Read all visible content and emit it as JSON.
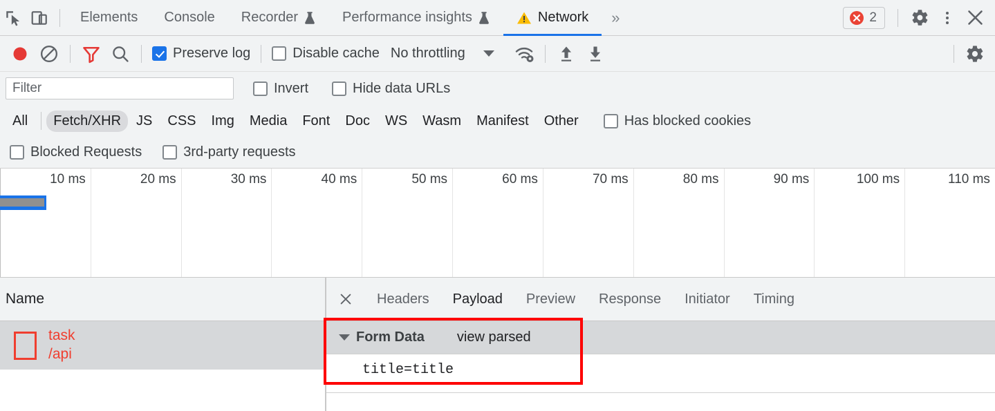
{
  "tabbar": {
    "inspect_icon": "inspect-cursor-icon",
    "device_icon": "device-toolbar-icon",
    "tabs": [
      {
        "label": "Elements",
        "selected": false,
        "flask": false,
        "warning": false
      },
      {
        "label": "Console",
        "selected": false,
        "flask": false,
        "warning": false
      },
      {
        "label": "Recorder",
        "selected": false,
        "flask": true,
        "warning": false
      },
      {
        "label": "Performance insights",
        "selected": false,
        "flask": true,
        "warning": false
      },
      {
        "label": "Network",
        "selected": true,
        "flask": false,
        "warning": true
      }
    ],
    "more_tabs": "»",
    "error_count": "2",
    "settings_icon": "gear-icon",
    "menu_icon": "kebab-menu-icon",
    "close_icon": "close-icon"
  },
  "network_toolbar": {
    "record_icon": "record-button-icon",
    "clear_icon": "clear-icon",
    "filter_icon": "filter-funnel-icon",
    "search_icon": "search-icon",
    "preserve_log": {
      "label": "Preserve log",
      "checked": true
    },
    "disable_cache": {
      "label": "Disable cache",
      "checked": false
    },
    "throttling": {
      "value": "No throttling"
    },
    "network_conditions_icon": "wifi-settings-icon",
    "import_icon": "import-har-icon",
    "export_icon": "export-har-icon",
    "settings_icon": "gear-icon"
  },
  "filter_row": {
    "filter_placeholder": "Filter",
    "filter_value": "",
    "invert": {
      "label": "Invert",
      "checked": false
    },
    "hide_data_urls": {
      "label": "Hide data URLs",
      "checked": false
    }
  },
  "type_filters": {
    "all": "All",
    "types": [
      {
        "label": "Fetch/XHR",
        "active": true
      },
      {
        "label": "JS",
        "active": false
      },
      {
        "label": "CSS",
        "active": false
      },
      {
        "label": "Img",
        "active": false
      },
      {
        "label": "Media",
        "active": false
      },
      {
        "label": "Font",
        "active": false
      },
      {
        "label": "Doc",
        "active": false
      },
      {
        "label": "WS",
        "active": false
      },
      {
        "label": "Wasm",
        "active": false
      },
      {
        "label": "Manifest",
        "active": false
      },
      {
        "label": "Other",
        "active": false
      }
    ],
    "has_blocked_cookies": {
      "label": "Has blocked cookies",
      "checked": false
    }
  },
  "blocked_row": {
    "blocked_requests": {
      "label": "Blocked Requests",
      "checked": false
    },
    "third_party": {
      "label": "3rd-party requests",
      "checked": false
    }
  },
  "overview": {
    "ticks": [
      "10 ms",
      "20 ms",
      "30 ms",
      "40 ms",
      "50 ms",
      "60 ms",
      "70 ms",
      "80 ms",
      "90 ms",
      "100 ms",
      "110 ms"
    ],
    "bar_color": "#1a73e8",
    "bar_inner_color": "#909090"
  },
  "request_list": {
    "column_name": "Name",
    "rows": [
      {
        "icon": "document-error-icon",
        "name": "task",
        "path": "/api",
        "selected": true,
        "color": "#f03e2f"
      }
    ]
  },
  "detail_pane": {
    "close_icon": "close-icon",
    "tabs": [
      {
        "label": "Headers",
        "selected": false
      },
      {
        "label": "Payload",
        "selected": true
      },
      {
        "label": "Preview",
        "selected": false
      },
      {
        "label": "Response",
        "selected": false
      },
      {
        "label": "Initiator",
        "selected": false
      },
      {
        "label": "Timing",
        "selected": false
      }
    ],
    "payload": {
      "section_title": "Form Data",
      "view_toggle": "view parsed",
      "entries": [
        "title=title"
      ]
    },
    "annotation_color": "#fe0000"
  }
}
